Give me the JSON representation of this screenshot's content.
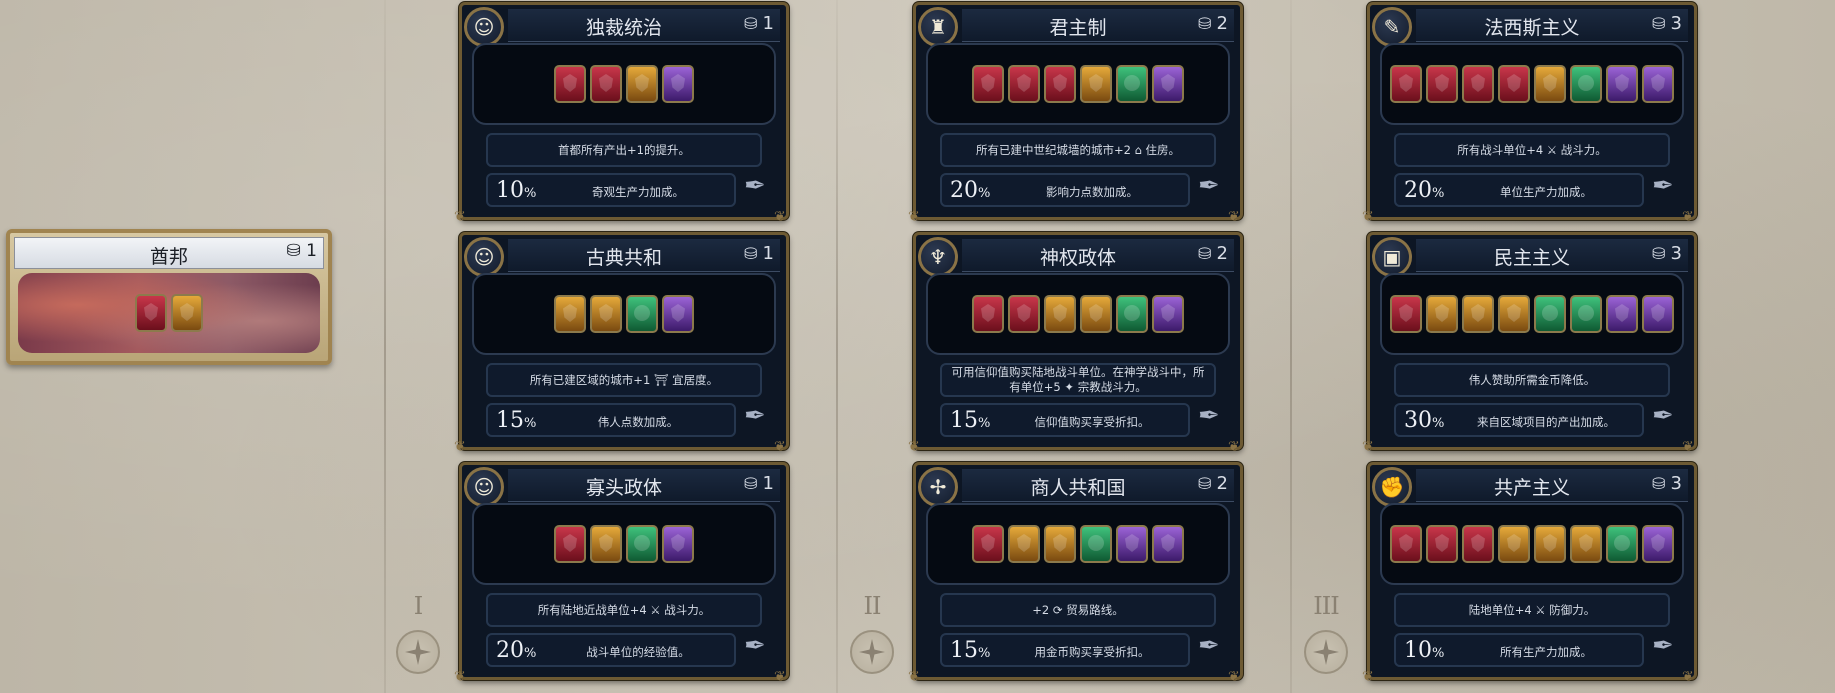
{
  "colors": {
    "military": "#c8364a",
    "economic": "#e5a93a",
    "diplomatic": "#3fc27c",
    "wildcard": "#9b63d6",
    "card_border": "#6d5a33"
  },
  "era_labels": [
    "I",
    "II",
    "III"
  ],
  "chiefdom": {
    "title": "酋邦",
    "era": "1",
    "slots": [
      "military",
      "economic"
    ]
  },
  "cards": [
    {
      "title": "独裁统治",
      "era": "1",
      "icon": "bust-icon",
      "slots": [
        "military",
        "military",
        "economic",
        "wildcard"
      ],
      "desc": "首都所有产出+1的提升。",
      "pct": "10",
      "bonus": "奇观生产力加成。"
    },
    {
      "title": "古典共和",
      "era": "1",
      "icon": "bust-icon",
      "slots": [
        "economic",
        "economic",
        "diplomatic",
        "wildcard"
      ],
      "desc": "所有已建区域的城市+1 ⛩ 宜居度。",
      "pct": "15",
      "bonus": "伟人点数加成。"
    },
    {
      "title": "寡头政体",
      "era": "1",
      "icon": "bust-icon",
      "slots": [
        "military",
        "economic",
        "diplomatic",
        "wildcard"
      ],
      "desc": "所有陆地近战单位+4 ⚔ 战斗力。",
      "pct": "20",
      "bonus": "战斗单位的经验值。"
    },
    {
      "title": "君主制",
      "era": "2",
      "icon": "helmet-icon",
      "slots": [
        "military",
        "military",
        "military",
        "economic",
        "diplomatic",
        "wildcard"
      ],
      "desc": "所有已建中世纪城墙的城市+2 ⌂ 住房。",
      "pct": "20",
      "bonus": "影响力点数加成。"
    },
    {
      "title": "神权政体",
      "era": "2",
      "icon": "wings-icon",
      "slots": [
        "military",
        "military",
        "economic",
        "economic",
        "diplomatic",
        "wildcard"
      ],
      "desc": "可用信仰值购买陆地战斗单位。在神学战斗中，所有单位+5 ✦ 宗教战斗力。",
      "pct": "15",
      "bonus": "信仰值购买享受折扣。"
    },
    {
      "title": "商人共和国",
      "era": "2",
      "icon": "compass-icon",
      "slots": [
        "military",
        "economic",
        "economic",
        "diplomatic",
        "wildcard",
        "wildcard"
      ],
      "desc": "+2 ⟳ 贸易路线。",
      "pct": "15",
      "bonus": "用金币购买享受折扣。"
    },
    {
      "title": "法西斯主义",
      "era": "3",
      "icon": "torch-icon",
      "slots": [
        "military",
        "military",
        "military",
        "military",
        "economic",
        "diplomatic",
        "wildcard",
        "wildcard"
      ],
      "desc": "所有战斗单位+4 ⚔ 战斗力。",
      "pct": "20",
      "bonus": "单位生产力加成。"
    },
    {
      "title": "民主主义",
      "era": "3",
      "icon": "ballot-icon",
      "slots": [
        "military",
        "economic",
        "economic",
        "economic",
        "diplomatic",
        "diplomatic",
        "wildcard",
        "wildcard"
      ],
      "desc": "伟人赞助所需金币降低。",
      "pct": "30",
      "bonus": "来自区域项目的产出加成。"
    },
    {
      "title": "共产主义",
      "era": "3",
      "icon": "fist-icon",
      "slots": [
        "military",
        "military",
        "military",
        "economic",
        "economic",
        "economic",
        "diplomatic",
        "wildcard"
      ],
      "desc": "陆地单位+4 ⚔ 防御力。",
      "pct": "10",
      "bonus": "所有生产力加成。"
    }
  ]
}
